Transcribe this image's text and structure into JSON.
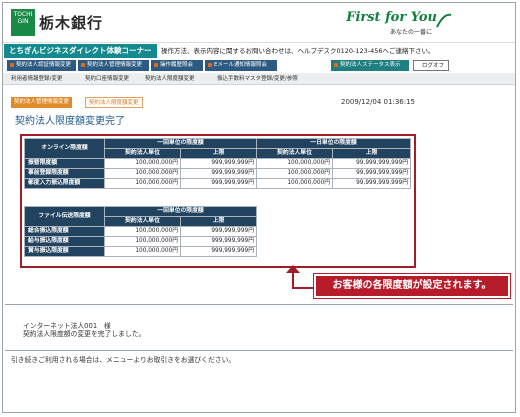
{
  "header": {
    "logo_mark_top": "TOCHI",
    "logo_mark_bottom": "GIN",
    "bank_name": "栃木銀行",
    "slogan": "First for You",
    "slogan_sub": "あなたの一番に"
  },
  "corner": {
    "title": "とちぎんビジネスダイレクト体験コーナー",
    "info": "操作方法、表示内容に関するお問い合わせは、ヘルプデスク0120-123-456へご連絡下さい。"
  },
  "nav": {
    "items": [
      "契約法人認証情報変更",
      "契約法人管理情報変更",
      "操作履歴照会",
      "Eメール通知情報照会",
      "契約法人ステータス表示"
    ],
    "logout": "ログオフ"
  },
  "subnav": {
    "items": [
      "利用者情報登録/変更",
      "契約口座情報変更",
      "契約法人限度額変更",
      "振込手数料マスタ登録/変更/参照"
    ]
  },
  "breadcrumb": {
    "parent": "契約法人管理情報変更",
    "current": "契約法人限度額変更"
  },
  "datetime": "2009/12/04 01:36:15",
  "page_title": "契約法人限度額変更完了",
  "online_table": {
    "corner_label": "オンライン限度額",
    "group1": "一回単位の限度額",
    "group2": "一日単位の限度額",
    "col_contract": "契約法人単位",
    "col_limit": "上限",
    "rows": [
      {
        "label": "振替限度額",
        "v1": "100,000,000円",
        "v2": "999,999,999円",
        "v3": "100,000,000円",
        "v4": "99,999,999,999円"
      },
      {
        "label": "事前登録限度額",
        "v1": "100,000,000円",
        "v2": "999,999,999円",
        "v3": "100,000,000円",
        "v4": "99,999,999,999円"
      },
      {
        "label": "都度入力振込限度額",
        "v1": "100,000,000円",
        "v2": "999,999,999円",
        "v3": "100,000,000円",
        "v4": "99,999,999,999円"
      }
    ]
  },
  "file_table": {
    "corner_label": "ファイル伝送限度額",
    "group1": "一回単位の限度額",
    "col_contract": "契約法人単位",
    "col_limit": "上限",
    "rows": [
      {
        "label": "総合振込限度額",
        "v1": "100,000,000円",
        "v2": "999,999,999円"
      },
      {
        "label": "給与振込限度額",
        "v1": "100,000,000円",
        "v2": "999,999,999円"
      },
      {
        "label": "賞与振込限度額",
        "v1": "100,000,000円",
        "v2": "999,999,999円"
      }
    ]
  },
  "callout": "お客様の各限度額が設定されます。",
  "messages": {
    "user": "インターネット法人001　様",
    "done": "契約法人限度額の変更を完了しました。",
    "next": "引き続きご利用される場合は、メニューよりお取引きをお選びください。"
  },
  "colors": {
    "brand_green": "#1a8b47",
    "nav_blue": "#2c5a82",
    "table_header": "#21435f",
    "callout_red": "#b71c2a"
  }
}
